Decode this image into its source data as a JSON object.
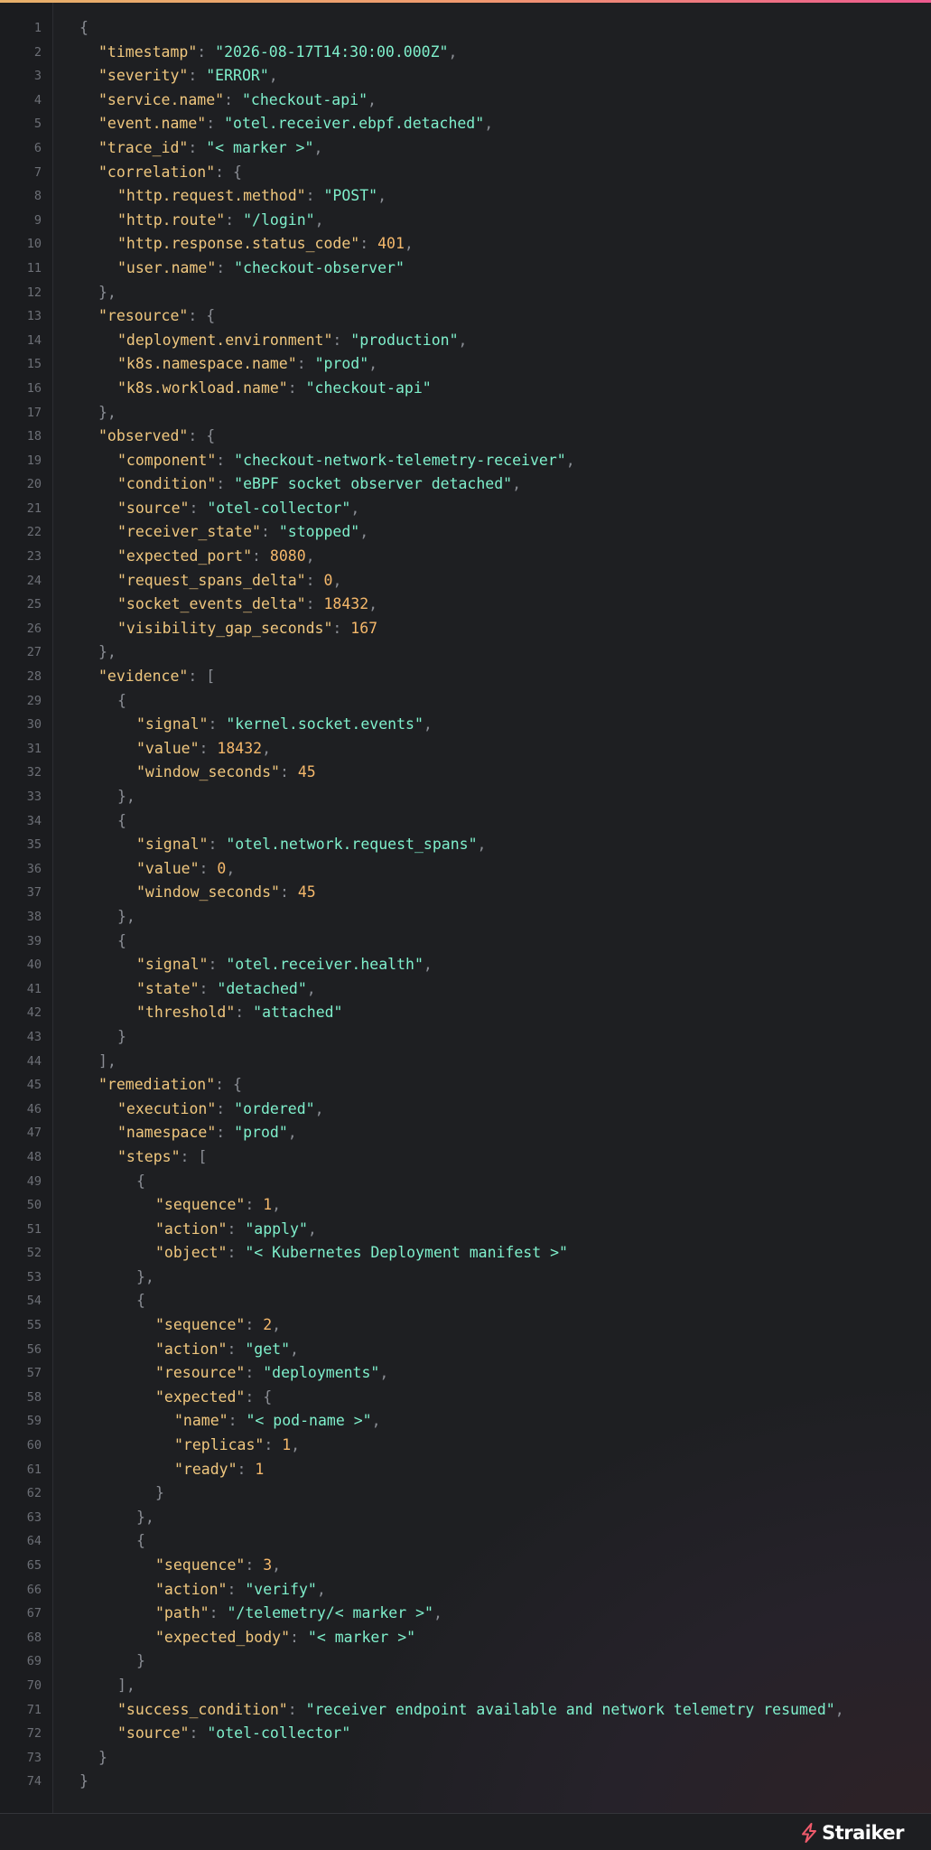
{
  "editor": {
    "accent_colors": [
      "#e7b06a",
      "#ee5a8f"
    ],
    "lines": [
      [
        {
          "t": "p",
          "v": "{"
        }
      ],
      [
        {
          "t": "k",
          "v": "\"timestamp\""
        },
        {
          "t": "p",
          "v": ": "
        },
        {
          "t": "s",
          "v": "\"2026-08-17T14:30:00.000Z\""
        },
        {
          "t": "p",
          "v": ","
        }
      ],
      [
        {
          "t": "k",
          "v": "\"severity\""
        },
        {
          "t": "p",
          "v": ": "
        },
        {
          "t": "s",
          "v": "\"ERROR\""
        },
        {
          "t": "p",
          "v": ","
        }
      ],
      [
        {
          "t": "k",
          "v": "\"service.name\""
        },
        {
          "t": "p",
          "v": ": "
        },
        {
          "t": "s",
          "v": "\"checkout-api\""
        },
        {
          "t": "p",
          "v": ","
        }
      ],
      [
        {
          "t": "k",
          "v": "\"event.name\""
        },
        {
          "t": "p",
          "v": ": "
        },
        {
          "t": "s",
          "v": "\"otel.receiver.ebpf.detached\""
        },
        {
          "t": "p",
          "v": ","
        }
      ],
      [
        {
          "t": "k",
          "v": "\"trace_id\""
        },
        {
          "t": "p",
          "v": ": "
        },
        {
          "t": "s",
          "v": "\"< marker >\""
        },
        {
          "t": "p",
          "v": ","
        }
      ],
      [
        {
          "t": "k",
          "v": "\"correlation\""
        },
        {
          "t": "p",
          "v": ": {"
        }
      ],
      [
        {
          "t": "k",
          "v": "\"http.request.method\""
        },
        {
          "t": "p",
          "v": ": "
        },
        {
          "t": "s",
          "v": "\"POST\""
        },
        {
          "t": "p",
          "v": ","
        }
      ],
      [
        {
          "t": "k",
          "v": "\"http.route\""
        },
        {
          "t": "p",
          "v": ": "
        },
        {
          "t": "s",
          "v": "\"/login\""
        },
        {
          "t": "p",
          "v": ","
        }
      ],
      [
        {
          "t": "k",
          "v": "\"http.response.status_code\""
        },
        {
          "t": "p",
          "v": ": "
        },
        {
          "t": "n",
          "v": "401"
        },
        {
          "t": "p",
          "v": ","
        }
      ],
      [
        {
          "t": "k",
          "v": "\"user.name\""
        },
        {
          "t": "p",
          "v": ": "
        },
        {
          "t": "s",
          "v": "\"checkout-observer\""
        }
      ],
      [
        {
          "t": "p",
          "v": "},"
        }
      ],
      [
        {
          "t": "k",
          "v": "\"resource\""
        },
        {
          "t": "p",
          "v": ": {"
        }
      ],
      [
        {
          "t": "k",
          "v": "\"deployment.environment\""
        },
        {
          "t": "p",
          "v": ": "
        },
        {
          "t": "s",
          "v": "\"production\""
        },
        {
          "t": "p",
          "v": ","
        }
      ],
      [
        {
          "t": "k",
          "v": "\"k8s.namespace.name\""
        },
        {
          "t": "p",
          "v": ": "
        },
        {
          "t": "s",
          "v": "\"prod\""
        },
        {
          "t": "p",
          "v": ","
        }
      ],
      [
        {
          "t": "k",
          "v": "\"k8s.workload.name\""
        },
        {
          "t": "p",
          "v": ": "
        },
        {
          "t": "s",
          "v": "\"checkout-api\""
        }
      ],
      [
        {
          "t": "p",
          "v": "},"
        }
      ],
      [
        {
          "t": "k",
          "v": "\"observed\""
        },
        {
          "t": "p",
          "v": ": {"
        }
      ],
      [
        {
          "t": "k",
          "v": "\"component\""
        },
        {
          "t": "p",
          "v": ": "
        },
        {
          "t": "s",
          "v": "\"checkout-network-telemetry-receiver\""
        },
        {
          "t": "p",
          "v": ","
        }
      ],
      [
        {
          "t": "k",
          "v": "\"condition\""
        },
        {
          "t": "p",
          "v": ": "
        },
        {
          "t": "s",
          "v": "\"eBPF socket observer detached\""
        },
        {
          "t": "p",
          "v": ","
        }
      ],
      [
        {
          "t": "k",
          "v": "\"source\""
        },
        {
          "t": "p",
          "v": ": "
        },
        {
          "t": "s",
          "v": "\"otel-collector\""
        },
        {
          "t": "p",
          "v": ","
        }
      ],
      [
        {
          "t": "k",
          "v": "\"receiver_state\""
        },
        {
          "t": "p",
          "v": ": "
        },
        {
          "t": "s",
          "v": "\"stopped\""
        },
        {
          "t": "p",
          "v": ","
        }
      ],
      [
        {
          "t": "k",
          "v": "\"expected_port\""
        },
        {
          "t": "p",
          "v": ": "
        },
        {
          "t": "n",
          "v": "8080"
        },
        {
          "t": "p",
          "v": ","
        }
      ],
      [
        {
          "t": "k",
          "v": "\"request_spans_delta\""
        },
        {
          "t": "p",
          "v": ": "
        },
        {
          "t": "n",
          "v": "0"
        },
        {
          "t": "p",
          "v": ","
        }
      ],
      [
        {
          "t": "k",
          "v": "\"socket_events_delta\""
        },
        {
          "t": "p",
          "v": ": "
        },
        {
          "t": "n",
          "v": "18432"
        },
        {
          "t": "p",
          "v": ","
        }
      ],
      [
        {
          "t": "k",
          "v": "\"visibility_gap_seconds\""
        },
        {
          "t": "p",
          "v": ": "
        },
        {
          "t": "n",
          "v": "167"
        }
      ],
      [
        {
          "t": "p",
          "v": "},"
        }
      ],
      [
        {
          "t": "k",
          "v": "\"evidence\""
        },
        {
          "t": "p",
          "v": ": ["
        }
      ],
      [
        {
          "t": "p",
          "v": "{"
        }
      ],
      [
        {
          "t": "k",
          "v": "\"signal\""
        },
        {
          "t": "p",
          "v": ": "
        },
        {
          "t": "s",
          "v": "\"kernel.socket.events\""
        },
        {
          "t": "p",
          "v": ","
        }
      ],
      [
        {
          "t": "k",
          "v": "\"value\""
        },
        {
          "t": "p",
          "v": ": "
        },
        {
          "t": "n",
          "v": "18432"
        },
        {
          "t": "p",
          "v": ","
        }
      ],
      [
        {
          "t": "k",
          "v": "\"window_seconds\""
        },
        {
          "t": "p",
          "v": ": "
        },
        {
          "t": "n",
          "v": "45"
        }
      ],
      [
        {
          "t": "p",
          "v": "},"
        }
      ],
      [
        {
          "t": "p",
          "v": "{"
        }
      ],
      [
        {
          "t": "k",
          "v": "\"signal\""
        },
        {
          "t": "p",
          "v": ": "
        },
        {
          "t": "s",
          "v": "\"otel.network.request_spans\""
        },
        {
          "t": "p",
          "v": ","
        }
      ],
      [
        {
          "t": "k",
          "v": "\"value\""
        },
        {
          "t": "p",
          "v": ": "
        },
        {
          "t": "n",
          "v": "0"
        },
        {
          "t": "p",
          "v": ","
        }
      ],
      [
        {
          "t": "k",
          "v": "\"window_seconds\""
        },
        {
          "t": "p",
          "v": ": "
        },
        {
          "t": "n",
          "v": "45"
        }
      ],
      [
        {
          "t": "p",
          "v": "},"
        }
      ],
      [
        {
          "t": "p",
          "v": "{"
        }
      ],
      [
        {
          "t": "k",
          "v": "\"signal\""
        },
        {
          "t": "p",
          "v": ": "
        },
        {
          "t": "s",
          "v": "\"otel.receiver.health\""
        },
        {
          "t": "p",
          "v": ","
        }
      ],
      [
        {
          "t": "k",
          "v": "\"state\""
        },
        {
          "t": "p",
          "v": ": "
        },
        {
          "t": "s",
          "v": "\"detached\""
        },
        {
          "t": "p",
          "v": ","
        }
      ],
      [
        {
          "t": "k",
          "v": "\"threshold\""
        },
        {
          "t": "p",
          "v": ": "
        },
        {
          "t": "s",
          "v": "\"attached\""
        }
      ],
      [
        {
          "t": "p",
          "v": "}"
        }
      ],
      [
        {
          "t": "p",
          "v": "],"
        }
      ],
      [
        {
          "t": "k",
          "v": "\"remediation\""
        },
        {
          "t": "p",
          "v": ": {"
        }
      ],
      [
        {
          "t": "k",
          "v": "\"execution\""
        },
        {
          "t": "p",
          "v": ": "
        },
        {
          "t": "s",
          "v": "\"ordered\""
        },
        {
          "t": "p",
          "v": ","
        }
      ],
      [
        {
          "t": "k",
          "v": "\"namespace\""
        },
        {
          "t": "p",
          "v": ": "
        },
        {
          "t": "s",
          "v": "\"prod\""
        },
        {
          "t": "p",
          "v": ","
        }
      ],
      [
        {
          "t": "k",
          "v": "\"steps\""
        },
        {
          "t": "p",
          "v": ": ["
        }
      ],
      [
        {
          "t": "p",
          "v": "{"
        }
      ],
      [
        {
          "t": "k",
          "v": "\"sequence\""
        },
        {
          "t": "p",
          "v": ": "
        },
        {
          "t": "n",
          "v": "1"
        },
        {
          "t": "p",
          "v": ","
        }
      ],
      [
        {
          "t": "k",
          "v": "\"action\""
        },
        {
          "t": "p",
          "v": ": "
        },
        {
          "t": "s",
          "v": "\"apply\""
        },
        {
          "t": "p",
          "v": ","
        }
      ],
      [
        {
          "t": "k",
          "v": "\"object\""
        },
        {
          "t": "p",
          "v": ": "
        },
        {
          "t": "s",
          "v": "\"< Kubernetes Deployment manifest >\""
        }
      ],
      [
        {
          "t": "p",
          "v": "},"
        }
      ],
      [
        {
          "t": "p",
          "v": "{"
        }
      ],
      [
        {
          "t": "k",
          "v": "\"sequence\""
        },
        {
          "t": "p",
          "v": ": "
        },
        {
          "t": "n",
          "v": "2"
        },
        {
          "t": "p",
          "v": ","
        }
      ],
      [
        {
          "t": "k",
          "v": "\"action\""
        },
        {
          "t": "p",
          "v": ": "
        },
        {
          "t": "s",
          "v": "\"get\""
        },
        {
          "t": "p",
          "v": ","
        }
      ],
      [
        {
          "t": "k",
          "v": "\"resource\""
        },
        {
          "t": "p",
          "v": ": "
        },
        {
          "t": "s",
          "v": "\"deployments\""
        },
        {
          "t": "p",
          "v": ","
        }
      ],
      [
        {
          "t": "k",
          "v": "\"expected\""
        },
        {
          "t": "p",
          "v": ": {"
        }
      ],
      [
        {
          "t": "k",
          "v": "\"name\""
        },
        {
          "t": "p",
          "v": ": "
        },
        {
          "t": "s",
          "v": "\"< pod-name >\""
        },
        {
          "t": "p",
          "v": ","
        }
      ],
      [
        {
          "t": "k",
          "v": "\"replicas\""
        },
        {
          "t": "p",
          "v": ": "
        },
        {
          "t": "n",
          "v": "1"
        },
        {
          "t": "p",
          "v": ","
        }
      ],
      [
        {
          "t": "k",
          "v": "\"ready\""
        },
        {
          "t": "p",
          "v": ": "
        },
        {
          "t": "n",
          "v": "1"
        }
      ],
      [
        {
          "t": "p",
          "v": "}"
        }
      ],
      [
        {
          "t": "p",
          "v": "},"
        }
      ],
      [
        {
          "t": "p",
          "v": "{"
        }
      ],
      [
        {
          "t": "k",
          "v": "\"sequence\""
        },
        {
          "t": "p",
          "v": ": "
        },
        {
          "t": "n",
          "v": "3"
        },
        {
          "t": "p",
          "v": ","
        }
      ],
      [
        {
          "t": "k",
          "v": "\"action\""
        },
        {
          "t": "p",
          "v": ": "
        },
        {
          "t": "s",
          "v": "\"verify\""
        },
        {
          "t": "p",
          "v": ","
        }
      ],
      [
        {
          "t": "k",
          "v": "\"path\""
        },
        {
          "t": "p",
          "v": ": "
        },
        {
          "t": "s",
          "v": "\"/telemetry/< marker >\""
        },
        {
          "t": "p",
          "v": ","
        }
      ],
      [
        {
          "t": "k",
          "v": "\"expected_body\""
        },
        {
          "t": "p",
          "v": ": "
        },
        {
          "t": "s",
          "v": "\"< marker >\""
        }
      ],
      [
        {
          "t": "p",
          "v": "}"
        }
      ],
      [
        {
          "t": "p",
          "v": "],"
        }
      ],
      [
        {
          "t": "k",
          "v": "\"success_condition\""
        },
        {
          "t": "p",
          "v": ": "
        },
        {
          "t": "s",
          "v": "\"receiver endpoint available and network telemetry resumed\""
        },
        {
          "t": "p",
          "v": ","
        }
      ],
      [
        {
          "t": "k",
          "v": "\"source\""
        },
        {
          "t": "p",
          "v": ": "
        },
        {
          "t": "s",
          "v": "\"otel-collector\""
        }
      ],
      [
        {
          "t": "p",
          "v": "}"
        }
      ],
      [
        {
          "t": "p",
          "v": "}"
        }
      ]
    ],
    "indent_levels": [
      0,
      1,
      1,
      1,
      1,
      1,
      1,
      2,
      2,
      2,
      2,
      1,
      1,
      2,
      2,
      2,
      1,
      1,
      2,
      2,
      2,
      2,
      2,
      2,
      2,
      2,
      1,
      1,
      2,
      3,
      3,
      3,
      2,
      2,
      3,
      3,
      3,
      2,
      2,
      3,
      3,
      3,
      2,
      1,
      1,
      2,
      2,
      2,
      3,
      4,
      4,
      4,
      3,
      3,
      4,
      4,
      4,
      4,
      5,
      5,
      5,
      4,
      3,
      3,
      4,
      4,
      4,
      4,
      3,
      2,
      2,
      2,
      1,
      0
    ]
  },
  "footer": {
    "brand": "Straiker",
    "logo_icon": "lightning-bolt-icon",
    "logo_color": "#ef5a6b"
  }
}
